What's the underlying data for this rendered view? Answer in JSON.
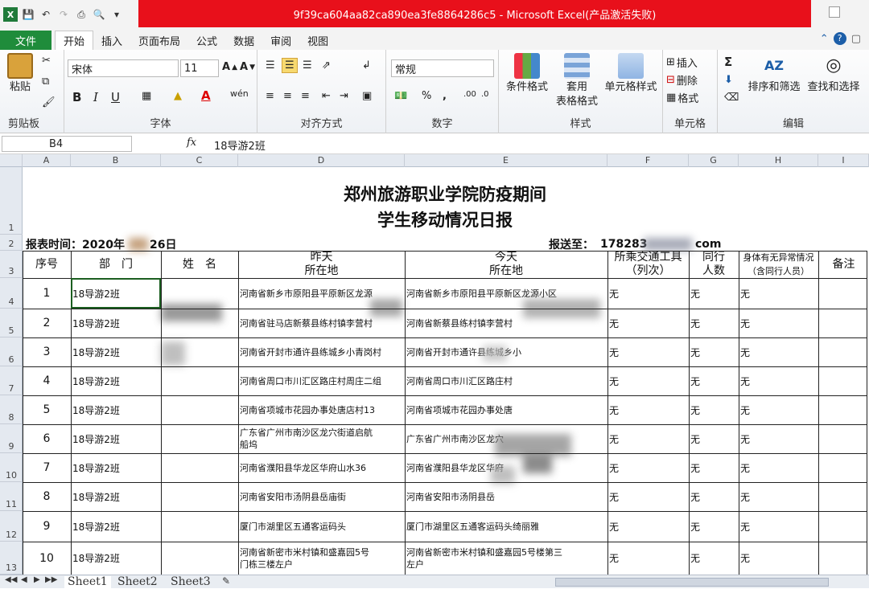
{
  "window": {
    "title": "9f39ca604aa82ca890ea3fe8864286c5 - Microsoft Excel(产品激活失败)"
  },
  "tabs": [
    "文件",
    "开始",
    "插入",
    "页面布局",
    "公式",
    "数据",
    "审阅",
    "视图"
  ],
  "ribbon": {
    "clipboard": {
      "label": "剪贴板",
      "paste": "粘贴"
    },
    "font": {
      "label": "字体",
      "name": "宋体",
      "size": "11",
      "bold": "B",
      "italic": "I",
      "underline": "U",
      "wen": "wén"
    },
    "align": {
      "label": "对齐方式"
    },
    "number": {
      "label": "数字",
      "format": "常规"
    },
    "styles": {
      "label": "样式",
      "cond": "条件格式",
      "table1": "套用",
      "table2": "表格格式",
      "cell": "单元格样式"
    },
    "cells": {
      "label": "单元格",
      "insert": "插入",
      "delete": "删除",
      "format": "格式"
    },
    "edit": {
      "label": "编辑",
      "sort": "排序和筛选",
      "find": "查找和选择"
    }
  },
  "formula_bar": {
    "cell_ref": "B4",
    "fx": "fx",
    "value": "18导游2班"
  },
  "columns": [
    "A",
    "B",
    "C",
    "D",
    "E",
    "F",
    "G",
    "H",
    "I"
  ],
  "rows": [
    "1",
    "2",
    "3",
    "4",
    "5",
    "6",
    "7",
    "8",
    "9",
    "10",
    "11",
    "12",
    "13"
  ],
  "sheet": {
    "title_line1": "郑州旅游职业学院防疫期间",
    "title_line2": "学生移动情况日报",
    "report_time": "报表时间：2020年",
    "report_date": "26日",
    "send_to_label": "报送至：",
    "send_to_num": "178283",
    "send_to_suffix": "com",
    "headers": {
      "no": "序号",
      "dept": "部　门",
      "name": "姓　名",
      "yest1": "昨天",
      "yest2": "所在地",
      "today1": "今天",
      "today2": "所在地",
      "trans1": "所乘交通工具",
      "trans2": "（列次）",
      "peer1": "同行",
      "peer2": "人数",
      "health1": "身体有无异常情况",
      "health2": "（含同行人员）",
      "note": "备注"
    },
    "records": [
      {
        "no": "1",
        "dept": "18导游2班",
        "yesterday": "河南省新乡市原阳县平原新区龙源",
        "today": "河南省新乡市原阳县平原新区龙源小区",
        "trans": "无",
        "peer": "无",
        "health": "无"
      },
      {
        "no": "2",
        "dept": "18导游2班",
        "yesterday": "河南省驻马店新蔡县练村镇李营村",
        "today": "河南省新蔡县练村镇李营村",
        "trans": "无",
        "peer": "无",
        "health": "无"
      },
      {
        "no": "3",
        "dept": "18导游2班",
        "yesterday": "河南省开封市通许县练城乡小青岗村",
        "today": "河南省开封市通许县练城乡小",
        "trans": "无",
        "peer": "无",
        "health": "无"
      },
      {
        "no": "4",
        "dept": "18导游2班",
        "yesterday": "河南省周口市川汇区路庄村周庄二组",
        "today": "河南省周口市川汇区路庄村",
        "trans": "无",
        "peer": "无",
        "health": "无"
      },
      {
        "no": "5",
        "dept": "18导游2班",
        "yesterday": "河南省项城市花园办事处唐店村13",
        "today": "河南省项城市花园办事处唐",
        "trans": "无",
        "peer": "无",
        "health": "无"
      },
      {
        "no": "6",
        "dept": "18导游2班",
        "yesterday": "广东省广州市南沙区龙穴街道启航",
        "yesterday2": "船坞",
        "today": "广东省广州市南沙区龙穴",
        "trans": "无",
        "peer": "无",
        "health": "无"
      },
      {
        "no": "7",
        "dept": "18导游2班",
        "yesterday": "河南省濮阳县华龙区华府山水36",
        "today": "河南省濮阳县华龙区华府",
        "trans": "无",
        "peer": "无",
        "health": "无"
      },
      {
        "no": "8",
        "dept": "18导游2班",
        "yesterday": "河南省安阳市汤阴县岳庙街",
        "today": "河南省安阳市汤阴县岳",
        "trans": "无",
        "peer": "无",
        "health": "无"
      },
      {
        "no": "9",
        "dept": "18导游2班",
        "yesterday": "厦门市湖里区五通客运码头",
        "today": "厦门市湖里区五通客运码头绮丽雅",
        "trans": "无",
        "peer": "无",
        "health": "无"
      },
      {
        "no": "10",
        "dept": "18导游2班",
        "yesterday": "河南省新密市米村镇和盛嘉园5号",
        "yesterday2": "门栋三楼左户",
        "today": "河南省新密市米村镇和盛嘉园5号楼第三",
        "today2": "左户",
        "trans": "无",
        "peer": "无",
        "health": "无"
      }
    ]
  },
  "sheet_tabs": [
    "Sheet1",
    "Sheet2",
    "Sheet3"
  ]
}
